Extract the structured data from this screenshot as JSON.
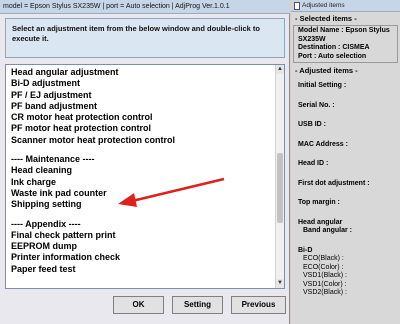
{
  "main_window": {
    "title": "model = Epson Stylus SX235W | port = Auto selection | AdjProg Ver.1.0.1",
    "instruction": "Select an adjustment item from the below window and double-click to execute it.",
    "list_items": [
      {
        "label": "Head angular adjustment",
        "gap": false
      },
      {
        "label": "Bi-D adjustment",
        "gap": false
      },
      {
        "label": "PF / EJ adjustment",
        "gap": false
      },
      {
        "label": "PF band adjustment",
        "gap": false
      },
      {
        "label": "CR motor heat protection control",
        "gap": false
      },
      {
        "label": "PF motor heat protection control",
        "gap": false
      },
      {
        "label": "Scanner motor heat protection control",
        "gap": false
      },
      {
        "label": "",
        "gap": true
      },
      {
        "label": "---- Maintenance ----",
        "gap": false
      },
      {
        "label": "Head cleaning",
        "gap": false
      },
      {
        "label": "Ink charge",
        "gap": false
      },
      {
        "label": "Waste ink pad counter",
        "gap": false
      },
      {
        "label": "Shipping setting",
        "gap": false
      },
      {
        "label": "",
        "gap": true
      },
      {
        "label": "---- Appendix ----",
        "gap": false
      },
      {
        "label": "Final check pattern print",
        "gap": false
      },
      {
        "label": "EEPROM dump",
        "gap": false
      },
      {
        "label": "Printer information check",
        "gap": false
      },
      {
        "label": "Paper feed test",
        "gap": false
      }
    ],
    "buttons": {
      "ok": "OK",
      "setting": "Setting",
      "previous": "Previous"
    },
    "annotation_arrow_color": "#e0201c"
  },
  "side_panel": {
    "title": "Adjusted items",
    "selected_header": "- Selected items -",
    "model_name": "Model Name : Epson Stylus SX235W",
    "destination": "Destination : CISMEA",
    "port": "Port : Auto selection",
    "adjusted_header": "- Adjusted items -",
    "fields": [
      {
        "label": "Initial Setting :",
        "style": "gap"
      },
      {
        "label": "Serial No. :",
        "style": "gap"
      },
      {
        "label": "USB ID :",
        "style": "gap"
      },
      {
        "label": "MAC Address :",
        "style": "gap"
      },
      {
        "label": "Head ID :",
        "style": "gap"
      },
      {
        "label": "First dot adjustment :",
        "style": "gap"
      },
      {
        "label": "Top margin :",
        "style": "gap"
      },
      {
        "label": "Head angular",
        "style": "none"
      },
      {
        "label": "Band angular :",
        "style": "indent gap"
      },
      {
        "label": "Bi-D",
        "style": "none"
      },
      {
        "label": "ECO(Black) :",
        "style": "indent small"
      },
      {
        "label": "ECO(Color) :",
        "style": "indent small"
      },
      {
        "label": "VSD1(Black) :",
        "style": "indent small"
      },
      {
        "label": "VSD1(Color) :",
        "style": "indent small"
      },
      {
        "label": "VSD2(Black) :",
        "style": "indent small"
      }
    ]
  }
}
